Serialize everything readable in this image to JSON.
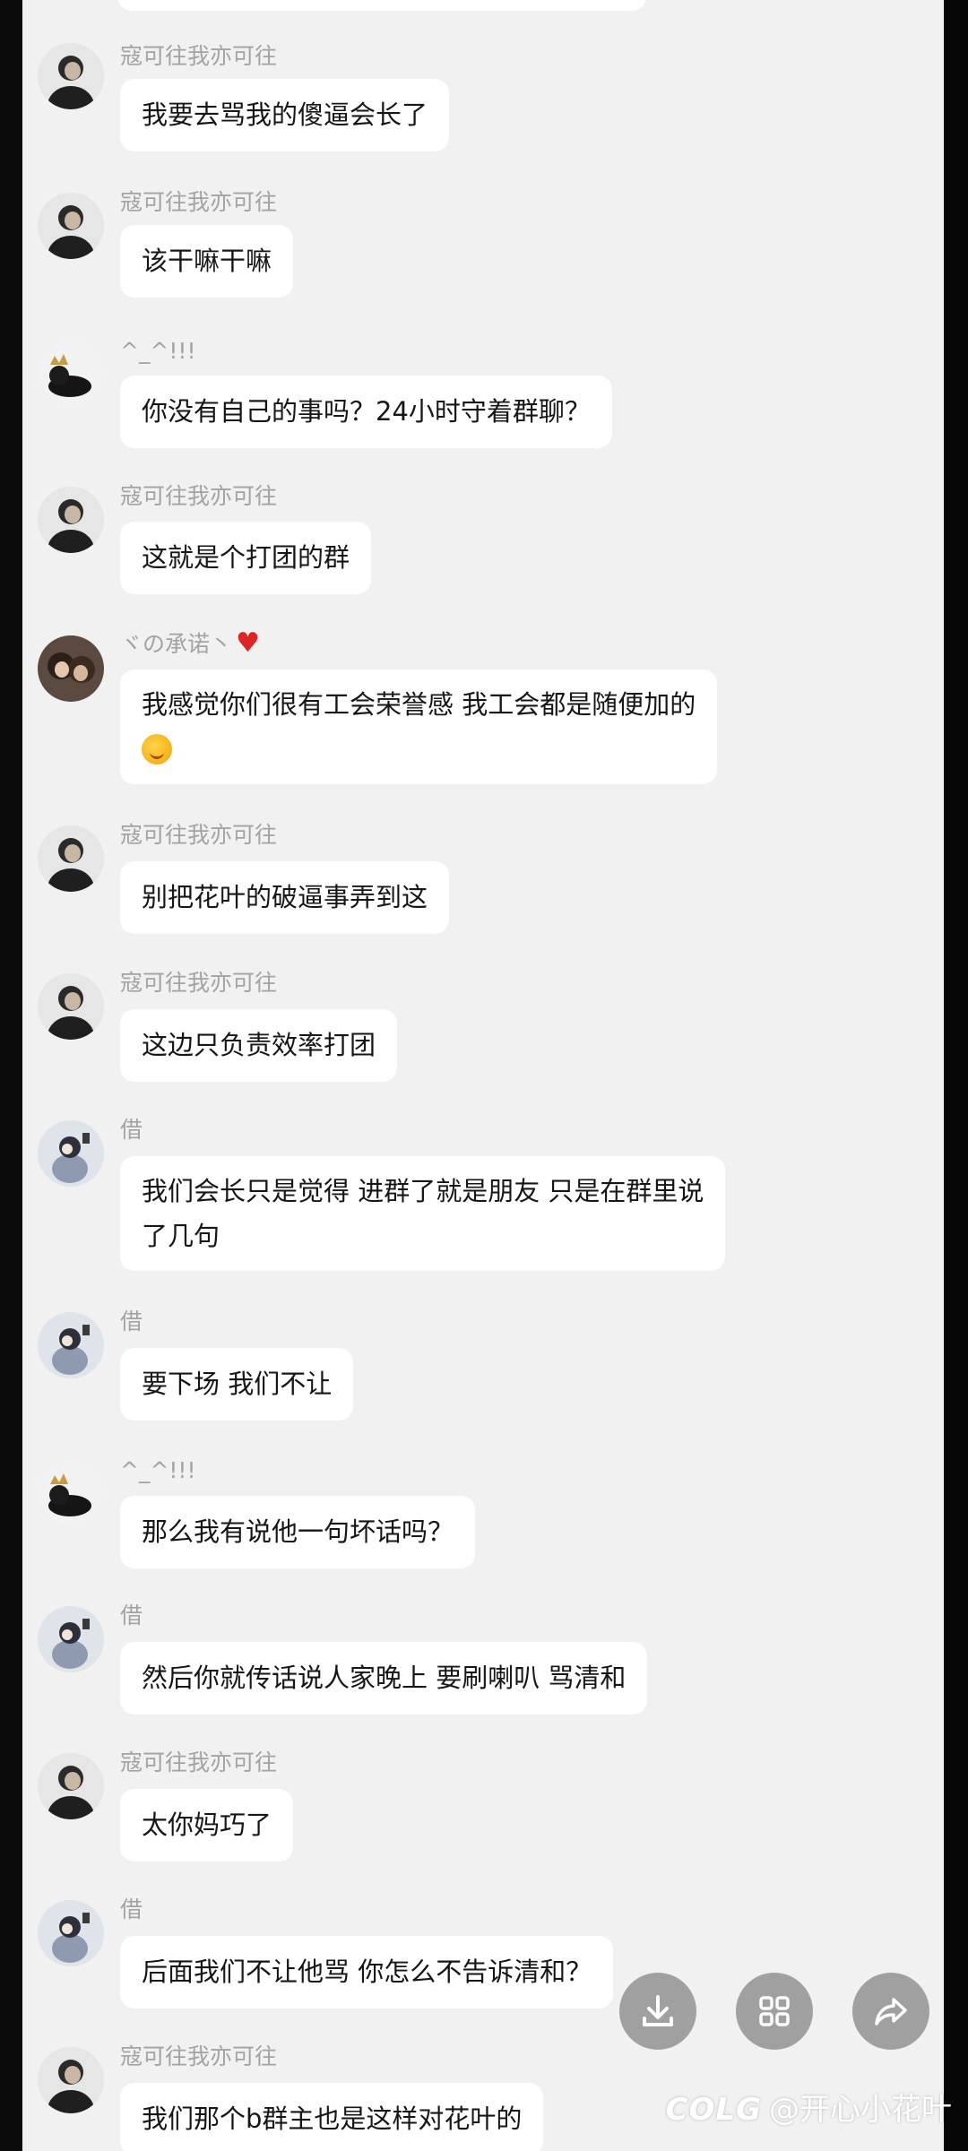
{
  "messages": [
    {
      "sender": "寇可往我亦可往",
      "avatar": "avatar-man-icon",
      "lines": [
        "我要去骂我的傻逼会长了"
      ]
    },
    {
      "sender": "寇可往我亦可往",
      "avatar": "avatar-man-icon",
      "lines": [
        "该干嘛干嘛"
      ]
    },
    {
      "sender": "^_^!!!",
      "avatar": "avatar-crown-icon",
      "lines": [
        "你没有自己的事吗？24小时守着群聊？"
      ]
    },
    {
      "sender": "寇可往我亦可往",
      "avatar": "avatar-man-icon",
      "lines": [
        "这就是个打团的群"
      ]
    },
    {
      "sender": "ヾの承诺丶",
      "avatar": "avatar-couple-icon",
      "lines": [
        "我感觉你们很有工会荣誉感  我工会都是随便加的"
      ]
    },
    {
      "sender": "寇可往我亦可往",
      "avatar": "avatar-man-icon",
      "lines": [
        "别把花叶的破逼事弄到这"
      ]
    },
    {
      "sender": "寇可往我亦可往",
      "avatar": "avatar-man-icon",
      "lines": [
        "这边只负责效率打团"
      ]
    },
    {
      "sender": "借",
      "avatar": "avatar-anime-icon",
      "lines": [
        "我们会长只是觉得 进群了就是朋友 只是在群里说",
        "了几句"
      ]
    },
    {
      "sender": "借",
      "avatar": "avatar-anime-icon",
      "lines": [
        "要下场 我们不让"
      ]
    },
    {
      "sender": "^_^!!!",
      "avatar": "avatar-crown-icon",
      "lines": [
        "那么我有说他一句坏话吗？"
      ]
    },
    {
      "sender": "借",
      "avatar": "avatar-anime-icon",
      "lines": [
        "然后你就传话说人家晚上 要刷喇叭 骂清和"
      ]
    },
    {
      "sender": "寇可往我亦可往",
      "avatar": "avatar-man-icon",
      "lines": [
        "太你妈巧了"
      ]
    },
    {
      "sender": "借",
      "avatar": "avatar-anime-icon",
      "lines": [
        "后面我们不让他骂  你怎么不告诉清和？"
      ]
    },
    {
      "sender": "寇可往我亦可往",
      "avatar": "avatar-man-icon",
      "lines": [
        "我们那个b群主也是这样对花叶的"
      ]
    }
  ],
  "fabs": [
    {
      "name": "download-button",
      "icon": "download-icon"
    },
    {
      "name": "grid-button",
      "icon": "grid-icon"
    },
    {
      "name": "share-button",
      "icon": "share-icon"
    }
  ],
  "watermark": {
    "logo": "COLG",
    "text": "@开心小花叶"
  },
  "colors": {
    "background": "#f1f1f1",
    "bubble": "#ffffff",
    "name": "#a3a3a3",
    "text": "#161616",
    "fab": "#9a9a9a"
  }
}
